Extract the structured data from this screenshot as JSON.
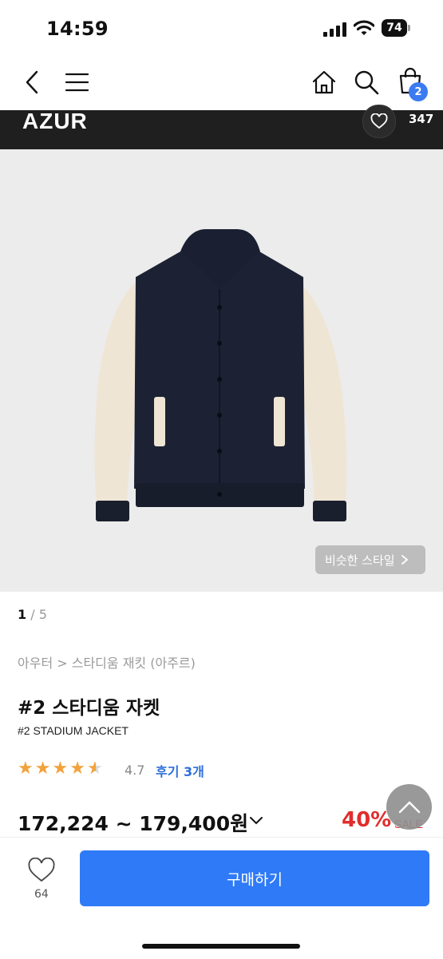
{
  "status_bar": {
    "time": "14:59",
    "battery": "74"
  },
  "nav": {
    "cart_count": "2"
  },
  "brand": {
    "name": "AZUR",
    "likes": "347"
  },
  "gallery": {
    "current": "1",
    "total": "5",
    "separator": " / ",
    "similar_label": "비슷한 스타일"
  },
  "product": {
    "breadcrumb": "아우터 > 스타디움 재킷 (아주르)",
    "title_ko": "#2 스타디움 자켓",
    "title_en": "#2 STADIUM JACKET",
    "rating": "4.7",
    "rating_stars": 4.7,
    "reviews": "후기 3개",
    "price": "172,224 ~ 179,400원",
    "discount": "40%",
    "sale_label": "SALE"
  },
  "bottom": {
    "like_count": "64",
    "buy_label": "구매하기"
  },
  "colors": {
    "accent": "#2f7af6",
    "sale": "#e02d2d",
    "star": "#f2a23c",
    "badge": "#3a7bf2"
  }
}
